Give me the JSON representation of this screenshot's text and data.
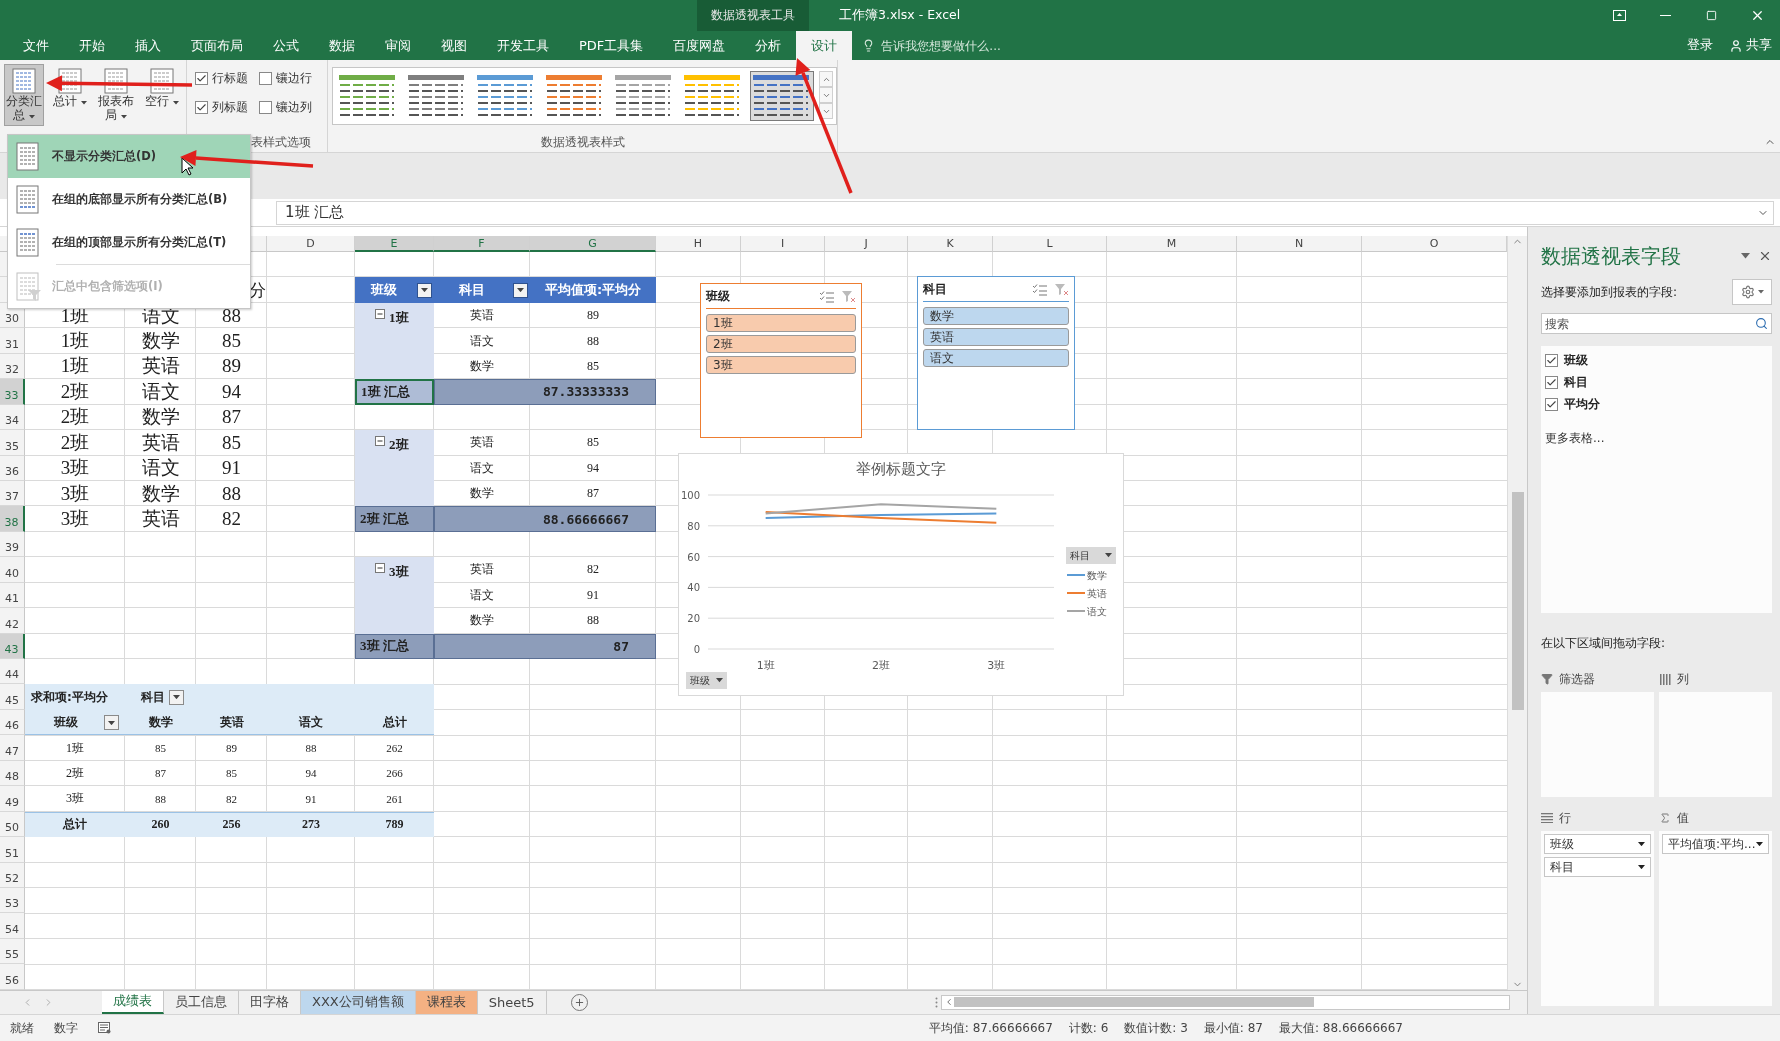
{
  "title_bar": {
    "context_label": "数据透视表工具",
    "title": "工作簿3.xlsx - Excel"
  },
  "menu_tabs": [
    {
      "label": "文件",
      "selected": false
    },
    {
      "label": "开始",
      "selected": false
    },
    {
      "label": "插入",
      "selected": false
    },
    {
      "label": "页面布局",
      "selected": false
    },
    {
      "label": "公式",
      "selected": false
    },
    {
      "label": "数据",
      "selected": false
    },
    {
      "label": "审阅",
      "selected": false
    },
    {
      "label": "视图",
      "selected": false
    },
    {
      "label": "开发工具",
      "selected": false
    },
    {
      "label": "PDF工具集",
      "selected": false
    },
    {
      "label": "百度网盘",
      "selected": false
    },
    {
      "label": "分析",
      "selected": false
    },
    {
      "label": "设计",
      "selected": true
    }
  ],
  "tell_me": {
    "placeholder": "告诉我您想要做什么..."
  },
  "account": {
    "sign_in": "登录",
    "share": "共享"
  },
  "ribbon": {
    "layout_buttons": [
      {
        "label": "分类汇总",
        "pressed": true
      },
      {
        "label": "总计",
        "pressed": false
      },
      {
        "label": "报表布局",
        "pressed": false
      },
      {
        "label": "空行",
        "pressed": false
      }
    ],
    "style_options": [
      {
        "label": "行标题",
        "checked": true
      },
      {
        "label": "镶边行",
        "checked": false
      },
      {
        "label": "列标题",
        "checked": true
      },
      {
        "label": "镶边列",
        "checked": false
      }
    ],
    "style_options_group": "表样式选项",
    "styles": [
      {
        "color": "#70ad47",
        "selected": false
      },
      {
        "color": "#7f7f7f",
        "selected": false
      },
      {
        "color": "#5b9bd5",
        "selected": false
      },
      {
        "color": "#ed7d31",
        "selected": false
      },
      {
        "color": "#a5a5a5",
        "selected": false
      },
      {
        "color": "#ffc000",
        "selected": false
      },
      {
        "color": "#4472c4",
        "selected": true
      }
    ],
    "styles_group": "数据透视表样式"
  },
  "subtotals_menu": [
    {
      "label": "不显示分类汇总(D)",
      "selected": true,
      "disabled": false
    },
    {
      "label": "在组的底部显示所有分类汇总(B)",
      "selected": false,
      "disabled": false
    },
    {
      "label": "在组的顶部显示所有分类汇总(T)",
      "selected": false,
      "disabled": false
    },
    {
      "label": "汇总中包含筛选项(I)",
      "selected": false,
      "disabled": true
    }
  ],
  "formula_bar": {
    "value": "1班 汇总"
  },
  "columns": [
    {
      "label": "D",
      "selected": false
    },
    {
      "label": "E",
      "selected": true
    },
    {
      "label": "F",
      "selected": true
    },
    {
      "label": "G",
      "selected": true
    },
    {
      "label": "H",
      "selected": false
    },
    {
      "label": "I",
      "selected": false
    },
    {
      "label": "J",
      "selected": false
    },
    {
      "label": "K",
      "selected": false
    },
    {
      "label": "L",
      "selected": false
    },
    {
      "label": "M",
      "selected": false
    },
    {
      "label": "N",
      "selected": false
    },
    {
      "label": "O",
      "selected": false
    }
  ],
  "row_numbers": [
    {
      "label": "30",
      "selected": false
    },
    {
      "label": "31",
      "selected": false
    },
    {
      "label": "32",
      "selected": false
    },
    {
      "label": "33",
      "selected": true
    },
    {
      "label": "34",
      "selected": false
    },
    {
      "label": "35",
      "selected": false
    },
    {
      "label": "36",
      "selected": false
    },
    {
      "label": "37",
      "selected": false
    },
    {
      "label": "38",
      "selected": true
    },
    {
      "label": "39",
      "selected": false
    },
    {
      "label": "40",
      "selected": false
    },
    {
      "label": "41",
      "selected": false
    },
    {
      "label": "42",
      "selected": false
    },
    {
      "label": "43",
      "selected": true
    },
    {
      "label": "44",
      "selected": false
    },
    {
      "label": "45",
      "selected": false
    },
    {
      "label": "46",
      "selected": false
    },
    {
      "label": "47",
      "selected": false
    },
    {
      "label": "48",
      "selected": false
    },
    {
      "label": "49",
      "selected": false
    },
    {
      "label": "50",
      "selected": false
    },
    {
      "label": "51",
      "selected": false
    },
    {
      "label": "52",
      "selected": false
    },
    {
      "label": "53",
      "selected": false
    },
    {
      "label": "54",
      "selected": false
    },
    {
      "label": "55",
      "selected": false
    },
    {
      "label": "56",
      "selected": false
    }
  ],
  "source_header_tail": "分",
  "source_rows": [
    {
      "class": "1班",
      "subject": "语文",
      "score": "88"
    },
    {
      "class": "1班",
      "subject": "数学",
      "score": "85"
    },
    {
      "class": "1班",
      "subject": "英语",
      "score": "89"
    },
    {
      "class": "2班",
      "subject": "语文",
      "score": "94"
    },
    {
      "class": "2班",
      "subject": "数学",
      "score": "87"
    },
    {
      "class": "2班",
      "subject": "英语",
      "score": "85"
    },
    {
      "class": "3班",
      "subject": "语文",
      "score": "91"
    },
    {
      "class": "3班",
      "subject": "数学",
      "score": "88"
    },
    {
      "class": "3班",
      "subject": "英语",
      "score": "82"
    }
  ],
  "pivot_table": {
    "headers": [
      "班级",
      "科目",
      "平均值项:平均分"
    ],
    "groups": [
      {
        "label": "1班",
        "expanded": true,
        "rows": [
          {
            "subject": "英语",
            "value": "89"
          },
          {
            "subject": "语文",
            "value": "88"
          },
          {
            "subject": "数学",
            "value": "85"
          }
        ],
        "total_label": "1班 汇总",
        "total": "87.33333333",
        "active": true
      },
      {
        "label": "2班",
        "expanded": true,
        "rows": [
          {
            "subject": "英语",
            "value": "85"
          },
          {
            "subject": "语文",
            "value": "94"
          },
          {
            "subject": "数学",
            "value": "87"
          }
        ],
        "total_label": "2班 汇总",
        "total": "88.66666667",
        "active": false
      },
      {
        "label": "3班",
        "expanded": true,
        "rows": [
          {
            "subject": "英语",
            "value": "82"
          },
          {
            "subject": "语文",
            "value": "91"
          },
          {
            "subject": "数学",
            "value": "88"
          }
        ],
        "total_label": "3班 汇总",
        "total": "87",
        "active": false
      }
    ]
  },
  "slicers": [
    {
      "title": "班级",
      "color": "#ed7d31",
      "items": [
        {
          "label": "1班",
          "selected": true
        },
        {
          "label": "2班",
          "selected": true
        },
        {
          "label": "3班",
          "selected": true
        }
      ]
    },
    {
      "title": "科目",
      "color": "#5b9bd5",
      "items": [
        {
          "label": "数学",
          "selected": true
        },
        {
          "label": "英语",
          "selected": true
        },
        {
          "label": "语文",
          "selected": true
        }
      ]
    }
  ],
  "chart": {
    "chart_data": {
      "type": "line",
      "title": "举例标题文字",
      "grid": true,
      "legend": true,
      "categories": [
        "1班",
        "2班",
        "3班"
      ],
      "ylim": [
        0,
        100
      ],
      "yticks": [
        0,
        20,
        40,
        60,
        80,
        100
      ],
      "series": [
        {
          "name": "数学",
          "color": "#5b9bd5",
          "values": [
            85,
            87,
            88
          ]
        },
        {
          "name": "英语",
          "color": "#ed7d31",
          "values": [
            89,
            85,
            82
          ]
        },
        {
          "name": "语文",
          "color": "#a5a5a5",
          "values": [
            88,
            94,
            91
          ]
        }
      ]
    },
    "legend_field": "科目",
    "axis_field": "班级"
  },
  "summary_table": {
    "corner": "求和项:平均分",
    "column_field": "科目",
    "row_field": "班级",
    "columns": [
      "数学",
      "英语",
      "语文",
      "总计"
    ],
    "rows": [
      {
        "label": "1班",
        "values": [
          "85",
          "89",
          "88",
          "262"
        ]
      },
      {
        "label": "2班",
        "values": [
          "87",
          "85",
          "94",
          "266"
        ]
      },
      {
        "label": "3班",
        "values": [
          "88",
          "82",
          "91",
          "261"
        ]
      }
    ],
    "total": {
      "label": "总计",
      "values": [
        "260",
        "256",
        "273",
        "789"
      ]
    }
  },
  "sheet_tabs": [
    {
      "label": "成绩表",
      "selected": true
    },
    {
      "label": "员工信息",
      "selected": false
    },
    {
      "label": "田字格",
      "selected": false
    },
    {
      "label": "XXX公司销售额",
      "selected": false,
      "color": "#bdd7ee"
    },
    {
      "label": "课程表",
      "selected": false,
      "color": "#f4b183"
    },
    {
      "label": "Sheet5",
      "selected": false
    }
  ],
  "status_bar": {
    "mode": "就绪",
    "input_mode": "数字",
    "stats": [
      "平均值: 87.66666667",
      "计数: 6",
      "数值计数: 3",
      "最小值: 87",
      "最大值: 88.66666667"
    ]
  },
  "field_pane": {
    "title": "数据透视表字段",
    "prompt": "选择要添加到报表的字段:",
    "search": {
      "placeholder": "搜索"
    },
    "fields": [
      {
        "label": "班级",
        "checked": true
      },
      {
        "label": "科目",
        "checked": true
      },
      {
        "label": "平均分",
        "checked": true
      }
    ],
    "more_tables": "更多表格...",
    "areas_prompt": "在以下区域间拖动字段:",
    "areas": [
      {
        "kind": "filter",
        "label": "筛选器"
      },
      {
        "kind": "columns",
        "label": "列"
      },
      {
        "kind": "rows",
        "label": "行",
        "items": [
          "班级",
          "科目"
        ]
      },
      {
        "kind": "values",
        "label": "值",
        "items": [
          "平均值项:平均..."
        ]
      }
    ]
  }
}
